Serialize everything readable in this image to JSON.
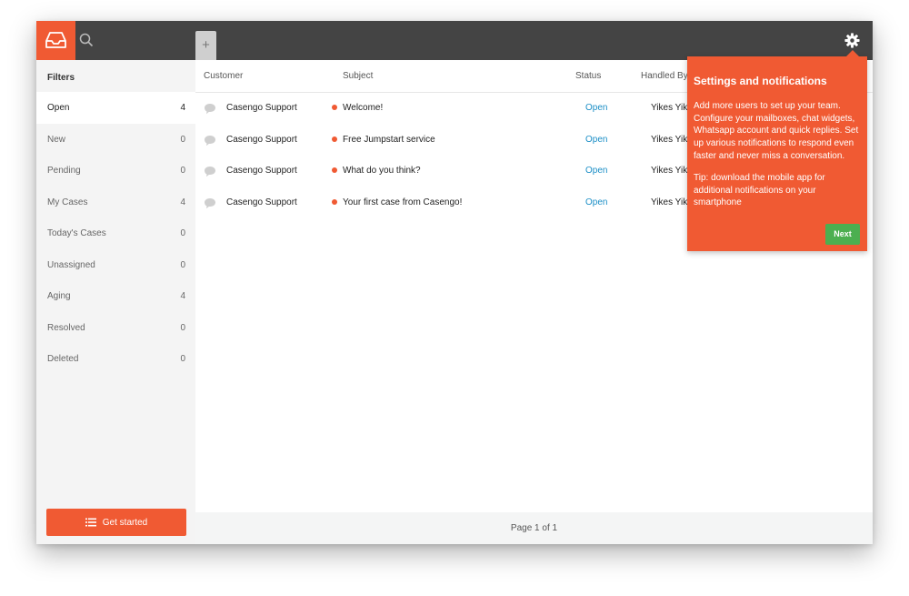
{
  "topbar": {
    "add_tab_label": "+"
  },
  "sidebar": {
    "title": "Filters",
    "items": [
      {
        "label": "Open",
        "count": "4"
      },
      {
        "label": "New",
        "count": "0"
      },
      {
        "label": "Pending",
        "count": "0"
      },
      {
        "label": "My Cases",
        "count": "4"
      },
      {
        "label": "Today's Cases",
        "count": "0"
      },
      {
        "label": "Unassigned",
        "count": "0"
      },
      {
        "label": "Aging",
        "count": "4"
      },
      {
        "label": "Resolved",
        "count": "0"
      },
      {
        "label": "Deleted",
        "count": "0"
      }
    ],
    "get_started_label": "Get started"
  },
  "table": {
    "headers": {
      "customer": "Customer",
      "subject": "Subject",
      "status": "Status",
      "handled_by": "Handled By"
    },
    "rows": [
      {
        "customer": "Casengo Support",
        "subject": "Welcome!",
        "status": "Open",
        "handled_by": "Yikes Yikes"
      },
      {
        "customer": "Casengo Support",
        "subject": "Free Jumpstart service",
        "status": "Open",
        "handled_by": "Yikes Yikes"
      },
      {
        "customer": "Casengo Support",
        "subject": "What do you think?",
        "status": "Open",
        "handled_by": "Yikes Yikes"
      },
      {
        "customer": "Casengo Support",
        "subject": "Your first case from Casengo!",
        "status": "Open",
        "handled_by": "Yikes Yikes"
      }
    ],
    "pagination": "Page 1 of 1"
  },
  "popover": {
    "title": "Settings and notifications",
    "body": "Add more users to set up your team. Configure your mailboxes, chat widgets, Whatsapp account and quick replies. Set up various notifications to respond even faster and never miss a conversation.",
    "tip": "Tip: download the mobile app for additional notifications on your smartphone",
    "next_label": "Next"
  },
  "colors": {
    "accent": "#f05a33",
    "topbar": "#444444",
    "status_open": "#1a8ec6",
    "next_button": "#4caf50"
  },
  "icons": [
    "inbox-icon",
    "search-icon",
    "gear-icon",
    "chat-bubble-icon",
    "list-icon"
  ]
}
